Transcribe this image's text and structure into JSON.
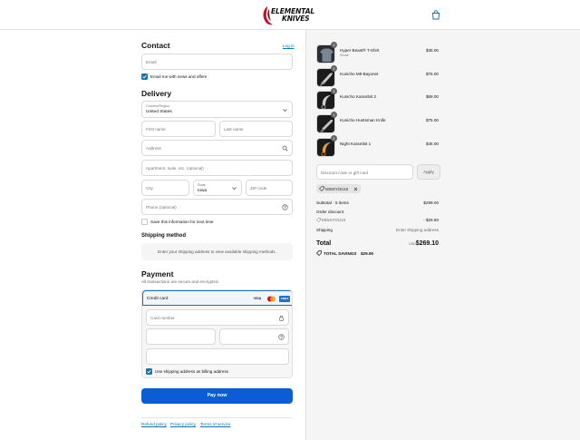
{
  "brand": {
    "line1": "ELEMENTAL",
    "line2": "KNIVES"
  },
  "contact": {
    "title": "Contact",
    "login_link": "Log in",
    "email_placeholder": "Email",
    "newsletter_label": "Email me with news and offers"
  },
  "delivery": {
    "title": "Delivery",
    "country_label": "Country/Region",
    "country_value": "United States",
    "first_name": "First name",
    "last_name": "Last name",
    "address": "Address",
    "apartment": "Apartment, suite, etc. (optional)",
    "city": "City",
    "state_label": "State",
    "state_value": "Iowa",
    "zip": "ZIP code",
    "phone": "Phone (optional)",
    "save_label": "Save this information for next time"
  },
  "shipping": {
    "title": "Shipping method",
    "message": "Enter your shipping address to view available shipping methods."
  },
  "payment": {
    "title": "Payment",
    "subtitle": "All transactions are secure and encrypted.",
    "method_label": "Credit card",
    "card_brands": {
      "visa": "VISA",
      "amex": "AMEX"
    },
    "card_number": "Card number",
    "billing_label": "Use shipping address as billing address",
    "pay_button": "Pay now"
  },
  "footer": {
    "refund": "Refund policy",
    "privacy": "Privacy policy",
    "terms": "Terms of service"
  },
  "order": {
    "items": [
      {
        "name": "Hyper Beast® T-Shirt",
        "variant": "Small",
        "price": "$35.00",
        "qty": "1"
      },
      {
        "name": "Kunicho M9 Bayonet",
        "variant": "",
        "price": "$75.00",
        "qty": "1"
      },
      {
        "name": "Kunicho Karambit 2",
        "variant": "",
        "price": "$69.00",
        "qty": "1"
      },
      {
        "name": "Kunicho Huntsman Knife",
        "variant": "",
        "price": "$75.00",
        "qty": "1"
      },
      {
        "name": "Night Karambit 1",
        "variant": "",
        "price": "$45.00",
        "qty": "1"
      }
    ],
    "discount_placeholder": "Discount code or gift card",
    "apply_label": "Apply",
    "code_tag": "MISSYOU10",
    "subtotal_label": "Subtotal · 5 items",
    "subtotal_value": "$299.00",
    "order_discount_label": "Order discount",
    "discount_code": "MISSYOU10",
    "discount_value": "- $29.90",
    "shipping_label": "Shipping",
    "shipping_value": "Enter shipping address",
    "total_label": "Total",
    "currency": "USD",
    "total_value": "$269.10",
    "savings_label": "TOTAL SAVINGS",
    "savings_value": "$29.90"
  },
  "colors": {
    "accent": "#1773b0",
    "pay_button": "#0b5cd5",
    "logo_red": "#c8102e"
  }
}
